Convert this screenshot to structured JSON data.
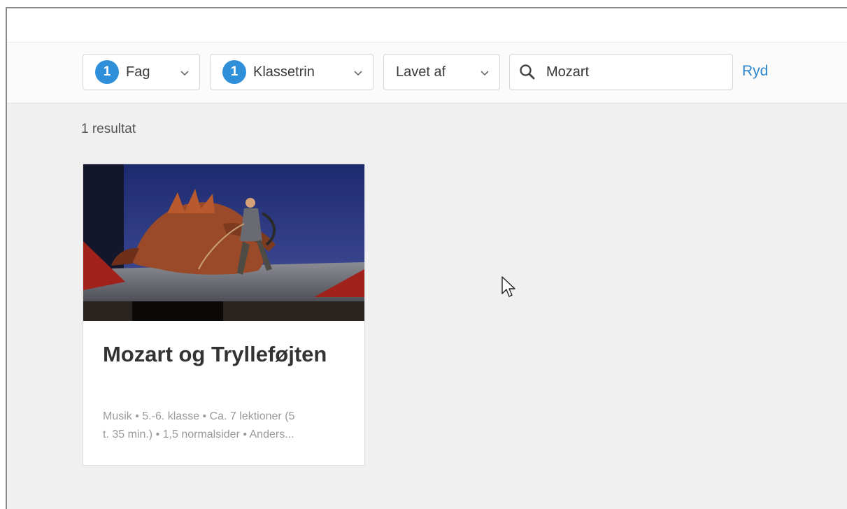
{
  "filters": {
    "subject": {
      "badge": "1",
      "label": "Fag"
    },
    "grade": {
      "badge": "1",
      "label": "Klassetrin"
    },
    "made_by": {
      "label": "Lavet af"
    }
  },
  "search": {
    "value": "Mozart",
    "icon": "search-icon"
  },
  "clear_label": "Ryd",
  "result_count": "1 resultat",
  "results": [
    {
      "title": "Mozart og Trylleføjten",
      "meta_line1": "Musik • 5.-6. klasse • Ca. 7 lektioner (5",
      "meta_line2": "t. 35 min.) • 1,5 normalsider • Anders..."
    }
  ],
  "colors": {
    "accent": "#2f8fd8",
    "link": "#2f86cc",
    "page_bg": "#f0f0f0"
  }
}
